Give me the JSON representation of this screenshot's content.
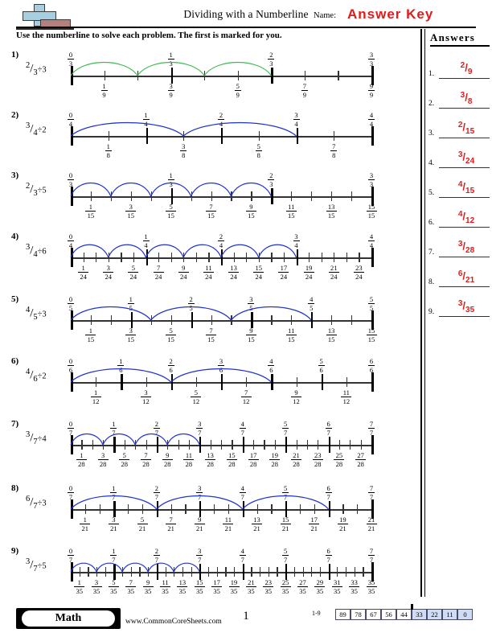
{
  "header": {
    "title": "Dividing with a Numberline",
    "name_label": "Name:",
    "name_value": "Answer Key",
    "instructions": "Use the numberline to solve each problem. The first is marked for you.",
    "logo_icon": "math-cross-logo"
  },
  "answers_panel": {
    "title": "Answers",
    "items": [
      {
        "index": "1.",
        "numerator": "2",
        "slash": "/",
        "denominator": "9"
      },
      {
        "index": "2.",
        "numerator": "3",
        "slash": "/",
        "denominator": "8"
      },
      {
        "index": "3.",
        "numerator": "2",
        "slash": "/",
        "denominator": "15"
      },
      {
        "index": "4.",
        "numerator": "3",
        "slash": "/",
        "denominator": "24"
      },
      {
        "index": "5.",
        "numerator": "4",
        "slash": "/",
        "denominator": "15"
      },
      {
        "index": "6.",
        "numerator": "4",
        "slash": "/",
        "denominator": "12"
      },
      {
        "index": "7.",
        "numerator": "3",
        "slash": "/",
        "denominator": "28"
      },
      {
        "index": "8.",
        "numerator": "6",
        "slash": "/",
        "denominator": "21"
      },
      {
        "index": "9.",
        "numerator": "3",
        "slash": "/",
        "denominator": "35"
      }
    ],
    "answer_color": "#e01b1b"
  },
  "problems": [
    {
      "index": "1)",
      "numerator": "2",
      "slash": "/",
      "denominator": "3",
      "operator": "÷3",
      "divisor": 3,
      "whole_den": 3,
      "fine_den": 9,
      "arc_count": 3,
      "arc_step_fine": 2,
      "arc_color": "#3fbb53",
      "top_labels": [
        {
          "n": "0",
          "d": "3",
          "pos": 0
        },
        {
          "n": "1",
          "d": "3",
          "pos": 3
        },
        {
          "n": "2",
          "d": "3",
          "pos": 6
        },
        {
          "n": "3",
          "d": "3",
          "pos": 9
        }
      ],
      "bottom_labels": [
        {
          "n": "1",
          "d": "9",
          "pos": 1
        },
        {
          "n": "3",
          "d": "9",
          "pos": 3
        },
        {
          "n": "5",
          "d": "9",
          "pos": 5
        },
        {
          "n": "7",
          "d": "9",
          "pos": 7
        },
        {
          "n": "9",
          "d": "9",
          "pos": 9
        }
      ]
    },
    {
      "index": "2)",
      "numerator": "3",
      "slash": "/",
      "denominator": "4",
      "operator": "÷2",
      "divisor": 2,
      "whole_den": 4,
      "fine_den": 8,
      "arc_count": 2,
      "arc_step_fine": 3,
      "arc_color": "#2233cc",
      "top_labels": [
        {
          "n": "0",
          "d": "4",
          "pos": 0
        },
        {
          "n": "1",
          "d": "4",
          "pos": 2
        },
        {
          "n": "2",
          "d": "4",
          "pos": 4
        },
        {
          "n": "3",
          "d": "4",
          "pos": 6
        },
        {
          "n": "4",
          "d": "4",
          "pos": 8
        }
      ],
      "bottom_labels": [
        {
          "n": "1",
          "d": "8",
          "pos": 1
        },
        {
          "n": "3",
          "d": "8",
          "pos": 3
        },
        {
          "n": "5",
          "d": "8",
          "pos": 5
        },
        {
          "n": "7",
          "d": "8",
          "pos": 7
        }
      ]
    },
    {
      "index": "3)",
      "numerator": "2",
      "slash": "/",
      "denominator": "3",
      "operator": "÷5",
      "divisor": 5,
      "whole_den": 3,
      "fine_den": 15,
      "arc_count": 5,
      "arc_step_fine": 2,
      "arc_color": "#2233cc",
      "top_labels": [
        {
          "n": "0",
          "d": "3",
          "pos": 0
        },
        {
          "n": "1",
          "d": "3",
          "pos": 5
        },
        {
          "n": "2",
          "d": "3",
          "pos": 10
        },
        {
          "n": "3",
          "d": "3",
          "pos": 15
        }
      ],
      "bottom_labels": [
        {
          "n": "1",
          "d": "15",
          "pos": 1
        },
        {
          "n": "3",
          "d": "15",
          "pos": 3
        },
        {
          "n": "5",
          "d": "15",
          "pos": 5
        },
        {
          "n": "7",
          "d": "15",
          "pos": 7
        },
        {
          "n": "9",
          "d": "15",
          "pos": 9
        },
        {
          "n": "11",
          "d": "15",
          "pos": 11
        },
        {
          "n": "13",
          "d": "15",
          "pos": 13
        },
        {
          "n": "15",
          "d": "15",
          "pos": 15
        }
      ]
    },
    {
      "index": "4)",
      "numerator": "3",
      "slash": "/",
      "denominator": "4",
      "operator": "÷6",
      "divisor": 6,
      "whole_den": 4,
      "fine_den": 24,
      "arc_count": 6,
      "arc_step_fine": 3,
      "arc_color": "#2233cc",
      "top_labels": [
        {
          "n": "0",
          "d": "4",
          "pos": 0
        },
        {
          "n": "1",
          "d": "4",
          "pos": 6
        },
        {
          "n": "2",
          "d": "4",
          "pos": 12
        },
        {
          "n": "3",
          "d": "4",
          "pos": 18
        },
        {
          "n": "4",
          "d": "4",
          "pos": 24
        }
      ],
      "bottom_labels": [
        {
          "n": "1",
          "d": "24",
          "pos": 1
        },
        {
          "n": "3",
          "d": "24",
          "pos": 3
        },
        {
          "n": "5",
          "d": "24",
          "pos": 5
        },
        {
          "n": "7",
          "d": "24",
          "pos": 7
        },
        {
          "n": "9",
          "d": "24",
          "pos": 9
        },
        {
          "n": "11",
          "d": "24",
          "pos": 11
        },
        {
          "n": "13",
          "d": "24",
          "pos": 13
        },
        {
          "n": "15",
          "d": "24",
          "pos": 15
        },
        {
          "n": "17",
          "d": "24",
          "pos": 17
        },
        {
          "n": "19",
          "d": "24",
          "pos": 19
        },
        {
          "n": "21",
          "d": "24",
          "pos": 21
        },
        {
          "n": "23",
          "d": "24",
          "pos": 23
        }
      ]
    },
    {
      "index": "5)",
      "numerator": "4",
      "slash": "/",
      "denominator": "5",
      "operator": "÷3",
      "divisor": 3,
      "whole_den": 5,
      "fine_den": 15,
      "arc_count": 3,
      "arc_step_fine": 4,
      "arc_color": "#2233cc",
      "top_labels": [
        {
          "n": "0",
          "d": "5",
          "pos": 0
        },
        {
          "n": "1",
          "d": "5",
          "pos": 3
        },
        {
          "n": "2",
          "d": "5",
          "pos": 6
        },
        {
          "n": "3",
          "d": "5",
          "pos": 9
        },
        {
          "n": "4",
          "d": "5",
          "pos": 12
        },
        {
          "n": "5",
          "d": "5",
          "pos": 15
        }
      ],
      "bottom_labels": [
        {
          "n": "1",
          "d": "15",
          "pos": 1
        },
        {
          "n": "3",
          "d": "15",
          "pos": 3
        },
        {
          "n": "5",
          "d": "15",
          "pos": 5
        },
        {
          "n": "7",
          "d": "15",
          "pos": 7
        },
        {
          "n": "9",
          "d": "15",
          "pos": 9
        },
        {
          "n": "11",
          "d": "15",
          "pos": 11
        },
        {
          "n": "13",
          "d": "15",
          "pos": 13
        },
        {
          "n": "15",
          "d": "15",
          "pos": 15
        }
      ]
    },
    {
      "index": "6)",
      "numerator": "4",
      "slash": "/",
      "denominator": "6",
      "operator": "÷2",
      "divisor": 2,
      "whole_den": 6,
      "fine_den": 12,
      "arc_count": 2,
      "arc_step_fine": 4,
      "arc_color": "#2233cc",
      "top_labels": [
        {
          "n": "0",
          "d": "6",
          "pos": 0
        },
        {
          "n": "1",
          "d": "6",
          "pos": 2
        },
        {
          "n": "2",
          "d": "6",
          "pos": 4
        },
        {
          "n": "3",
          "d": "6",
          "pos": 6
        },
        {
          "n": "4",
          "d": "6",
          "pos": 8
        },
        {
          "n": "5",
          "d": "6",
          "pos": 10
        },
        {
          "n": "6",
          "d": "6",
          "pos": 12
        }
      ],
      "bottom_labels": [
        {
          "n": "1",
          "d": "12",
          "pos": 1
        },
        {
          "n": "3",
          "d": "12",
          "pos": 3
        },
        {
          "n": "5",
          "d": "12",
          "pos": 5
        },
        {
          "n": "7",
          "d": "12",
          "pos": 7
        },
        {
          "n": "9",
          "d": "12",
          "pos": 9
        },
        {
          "n": "11",
          "d": "12",
          "pos": 11
        }
      ]
    },
    {
      "index": "7)",
      "numerator": "3",
      "slash": "/",
      "denominator": "7",
      "operator": "÷4",
      "divisor": 4,
      "whole_den": 7,
      "fine_den": 28,
      "arc_count": 4,
      "arc_step_fine": 3,
      "arc_color": "#2233cc",
      "top_labels": [
        {
          "n": "0",
          "d": "7",
          "pos": 0
        },
        {
          "n": "1",
          "d": "7",
          "pos": 4
        },
        {
          "n": "2",
          "d": "7",
          "pos": 8
        },
        {
          "n": "3",
          "d": "7",
          "pos": 12
        },
        {
          "n": "4",
          "d": "7",
          "pos": 16
        },
        {
          "n": "5",
          "d": "7",
          "pos": 20
        },
        {
          "n": "6",
          "d": "7",
          "pos": 24
        },
        {
          "n": "7",
          "d": "7",
          "pos": 28
        }
      ],
      "bottom_labels": [
        {
          "n": "1",
          "d": "28",
          "pos": 1
        },
        {
          "n": "3",
          "d": "28",
          "pos": 3
        },
        {
          "n": "5",
          "d": "28",
          "pos": 5
        },
        {
          "n": "7",
          "d": "28",
          "pos": 7
        },
        {
          "n": "9",
          "d": "28",
          "pos": 9
        },
        {
          "n": "11",
          "d": "28",
          "pos": 11
        },
        {
          "n": "13",
          "d": "28",
          "pos": 13
        },
        {
          "n": "15",
          "d": "28",
          "pos": 15
        },
        {
          "n": "17",
          "d": "28",
          "pos": 17
        },
        {
          "n": "19",
          "d": "28",
          "pos": 19
        },
        {
          "n": "21",
          "d": "28",
          "pos": 21
        },
        {
          "n": "23",
          "d": "28",
          "pos": 23
        },
        {
          "n": "25",
          "d": "28",
          "pos": 25
        },
        {
          "n": "27",
          "d": "28",
          "pos": 27
        }
      ]
    },
    {
      "index": "8)",
      "numerator": "6",
      "slash": "/",
      "denominator": "7",
      "operator": "÷3",
      "divisor": 3,
      "whole_den": 7,
      "fine_den": 21,
      "arc_count": 3,
      "arc_step_fine": 6,
      "arc_color": "#2233cc",
      "top_labels": [
        {
          "n": "0",
          "d": "7",
          "pos": 0
        },
        {
          "n": "1",
          "d": "7",
          "pos": 3
        },
        {
          "n": "2",
          "d": "7",
          "pos": 6
        },
        {
          "n": "3",
          "d": "7",
          "pos": 9
        },
        {
          "n": "4",
          "d": "7",
          "pos": 12
        },
        {
          "n": "5",
          "d": "7",
          "pos": 15
        },
        {
          "n": "6",
          "d": "7",
          "pos": 18
        },
        {
          "n": "7",
          "d": "7",
          "pos": 21
        }
      ],
      "bottom_labels": [
        {
          "n": "1",
          "d": "21",
          "pos": 1
        },
        {
          "n": "3",
          "d": "21",
          "pos": 3
        },
        {
          "n": "5",
          "d": "21",
          "pos": 5
        },
        {
          "n": "7",
          "d": "21",
          "pos": 7
        },
        {
          "n": "9",
          "d": "21",
          "pos": 9
        },
        {
          "n": "11",
          "d": "21",
          "pos": 11
        },
        {
          "n": "13",
          "d": "21",
          "pos": 13
        },
        {
          "n": "15",
          "d": "21",
          "pos": 15
        },
        {
          "n": "17",
          "d": "21",
          "pos": 17
        },
        {
          "n": "19",
          "d": "21",
          "pos": 19
        },
        {
          "n": "21",
          "d": "21",
          "pos": 21
        }
      ]
    },
    {
      "index": "9)",
      "numerator": "3",
      "slash": "/",
      "denominator": "7",
      "operator": "÷5",
      "divisor": 5,
      "whole_den": 7,
      "fine_den": 35,
      "arc_count": 5,
      "arc_step_fine": 3,
      "arc_color": "#2233cc",
      "top_labels": [
        {
          "n": "0",
          "d": "7",
          "pos": 0
        },
        {
          "n": "1",
          "d": "7",
          "pos": 5
        },
        {
          "n": "2",
          "d": "7",
          "pos": 10
        },
        {
          "n": "3",
          "d": "7",
          "pos": 15
        },
        {
          "n": "4",
          "d": "7",
          "pos": 20
        },
        {
          "n": "5",
          "d": "7",
          "pos": 25
        },
        {
          "n": "6",
          "d": "7",
          "pos": 30
        },
        {
          "n": "7",
          "d": "7",
          "pos": 35
        }
      ],
      "bottom_labels": [
        {
          "n": "1",
          "d": "35",
          "pos": 1
        },
        {
          "n": "3",
          "d": "35",
          "pos": 3
        },
        {
          "n": "5",
          "d": "35",
          "pos": 5
        },
        {
          "n": "7",
          "d": "35",
          "pos": 7
        },
        {
          "n": "9",
          "d": "35",
          "pos": 9
        },
        {
          "n": "11",
          "d": "35",
          "pos": 11
        },
        {
          "n": "13",
          "d": "35",
          "pos": 13
        },
        {
          "n": "15",
          "d": "35",
          "pos": 15
        },
        {
          "n": "17",
          "d": "35",
          "pos": 17
        },
        {
          "n": "19",
          "d": "35",
          "pos": 19
        },
        {
          "n": "21",
          "d": "35",
          "pos": 21
        },
        {
          "n": "23",
          "d": "35",
          "pos": 23
        },
        {
          "n": "25",
          "d": "35",
          "pos": 25
        },
        {
          "n": "27",
          "d": "35",
          "pos": 27
        },
        {
          "n": "29",
          "d": "35",
          "pos": 29
        },
        {
          "n": "31",
          "d": "35",
          "pos": 31
        },
        {
          "n": "33",
          "d": "35",
          "pos": 33
        },
        {
          "n": "35",
          "d": "35",
          "pos": 35
        }
      ]
    }
  ],
  "footer": {
    "subject": "Math",
    "website": "www.CommonCoreSheets.com",
    "page_number": "1",
    "scale_label": "1-9",
    "scale_values": [
      "89",
      "78",
      "67",
      "56",
      "44",
      "33",
      "22",
      "11",
      "0"
    ],
    "scale_highlight_from": 5,
    "highlight_color": "#cfdcf5"
  }
}
